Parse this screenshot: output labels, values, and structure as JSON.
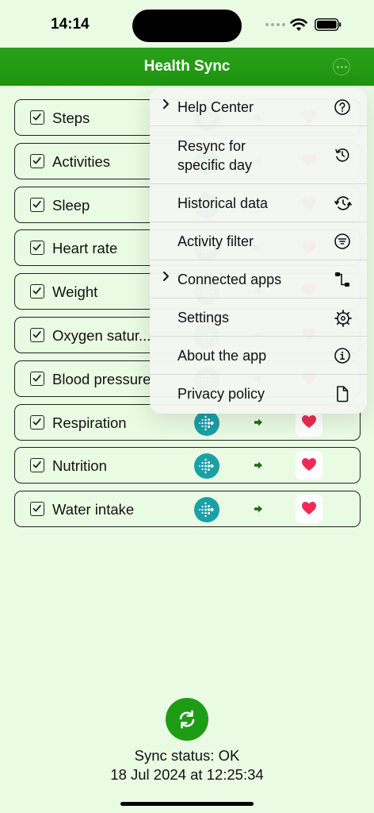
{
  "status_bar": {
    "time": "14:14"
  },
  "header": {
    "title": "Health Sync"
  },
  "rows": [
    {
      "label": "Steps",
      "checked": true
    },
    {
      "label": "Activities",
      "checked": true
    },
    {
      "label": "Sleep",
      "checked": true
    },
    {
      "label": "Heart rate",
      "checked": true
    },
    {
      "label": "Weight",
      "checked": true
    },
    {
      "label": "Oxygen satur...",
      "checked": true
    },
    {
      "label": "Blood pressure",
      "checked": true
    },
    {
      "label": "Respiration",
      "checked": true
    },
    {
      "label": "Nutrition",
      "checked": true
    },
    {
      "label": "Water intake",
      "checked": true
    }
  ],
  "menu": {
    "items": [
      {
        "label": "Help Center",
        "submenu": true,
        "icon": "question-circle-icon"
      },
      {
        "label": "Resync for specific day",
        "submenu": false,
        "icon": "clock-arrow-icon"
      },
      {
        "label": "Historical data",
        "submenu": false,
        "icon": "history-icon"
      },
      {
        "label": "Activity filter",
        "submenu": false,
        "icon": "filter-icon"
      },
      {
        "label": "Connected apps",
        "submenu": true,
        "icon": "flow-icon"
      },
      {
        "label": "Settings",
        "submenu": false,
        "icon": "gear-icon"
      },
      {
        "label": "About the app",
        "submenu": false,
        "icon": "info-icon"
      },
      {
        "label": "Privacy policy",
        "submenu": false,
        "icon": "document-icon"
      }
    ]
  },
  "footer": {
    "sync_status": "Sync status: OK",
    "sync_date": "18 Jul 2024 at 12:25:34"
  },
  "colors": {
    "background": "#eafbe3",
    "header": "#21970f",
    "fitbit": "#1aa0a8",
    "arrow": "#1f6b14",
    "heart": "#ef2b55",
    "sync_button": "#1f9c15"
  }
}
